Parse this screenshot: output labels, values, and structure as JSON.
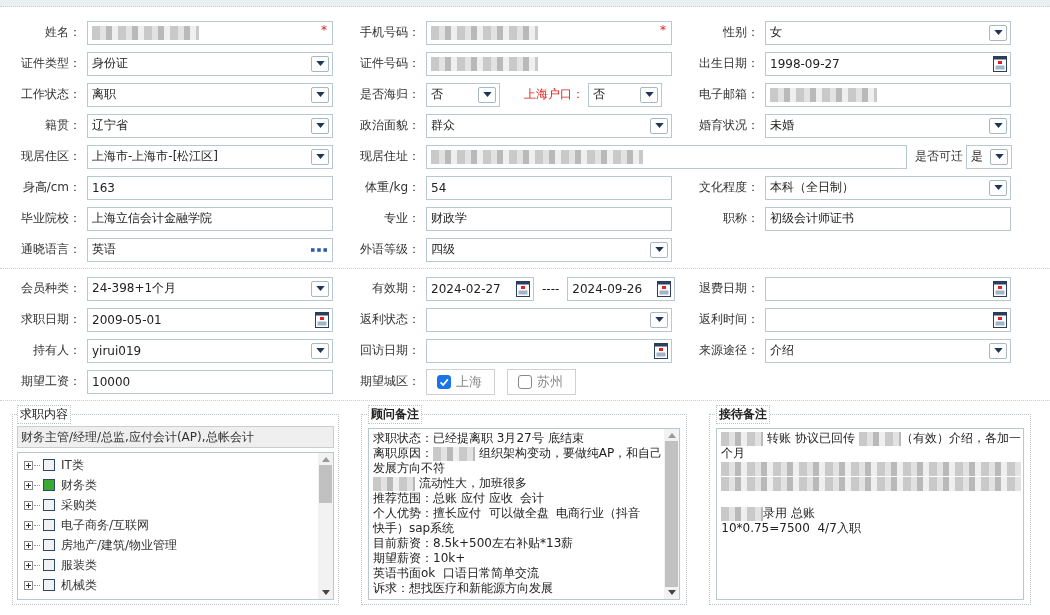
{
  "form_rows": [
    {
      "cells": [
        {
          "label": "姓名：",
          "parts": [
            {
              "kind": "blur",
              "required_mark": "*"
            }
          ]
        },
        {
          "label": "手机号码：",
          "parts": [
            {
              "kind": "blur",
              "required_mark": "*"
            }
          ]
        },
        {
          "label": "性别：",
          "parts": [
            {
              "kind": "select",
              "value": "女"
            }
          ]
        }
      ]
    },
    {
      "cells": [
        {
          "label": "证件类型：",
          "parts": [
            {
              "kind": "select",
              "value": "身份证"
            }
          ]
        },
        {
          "label": "证件号码：",
          "parts": [
            {
              "kind": "blur"
            }
          ]
        },
        {
          "label": "出生日期：",
          "parts": [
            {
              "kind": "date",
              "value": "1998-09-27"
            }
          ]
        }
      ]
    },
    {
      "cells": [
        {
          "label": "工作状态：",
          "parts": [
            {
              "kind": "select",
              "value": "离职"
            }
          ]
        },
        {
          "label": "是否海归：",
          "parts": [
            {
              "kind": "select",
              "value": "否"
            },
            {
              "kind": "label",
              "text": "上海户口：",
              "alert": true
            },
            {
              "kind": "select",
              "value": "否"
            }
          ]
        },
        {
          "label": "电子邮箱：",
          "parts": [
            {
              "kind": "blur"
            }
          ]
        }
      ]
    },
    {
      "cells": [
        {
          "label": "籍贯：",
          "parts": [
            {
              "kind": "select",
              "value": "辽宁省"
            }
          ]
        },
        {
          "label": "政治面貌：",
          "parts": [
            {
              "kind": "select",
              "value": "群众"
            }
          ]
        },
        {
          "label": "婚育状况：",
          "parts": [
            {
              "kind": "select",
              "value": "未婚"
            }
          ]
        }
      ]
    },
    {
      "cells": [
        {
          "label": "现居住区：",
          "parts": [
            {
              "kind": "select",
              "value": "上海市-上海市-[松江区]"
            }
          ]
        },
        {
          "label": "现居住址：",
          "wide": true,
          "parts": [
            {
              "kind": "blur"
            },
            {
              "kind": "label",
              "text": "是否可迁"
            },
            {
              "kind": "select",
              "value": "是"
            }
          ]
        }
      ]
    },
    {
      "cells": [
        {
          "label": "身高/cm：",
          "parts": [
            {
              "kind": "text",
              "value": "163"
            }
          ]
        },
        {
          "label": "体重/kg：",
          "parts": [
            {
              "kind": "text",
              "value": "54"
            }
          ]
        },
        {
          "label": "文化程度：",
          "parts": [
            {
              "kind": "select",
              "value": "本科（全日制）"
            }
          ]
        }
      ]
    },
    {
      "cells": [
        {
          "label": "毕业院校：",
          "parts": [
            {
              "kind": "text",
              "value": "上海立信会计金融学院"
            }
          ]
        },
        {
          "label": "专业：",
          "parts": [
            {
              "kind": "text",
              "value": "财政学"
            }
          ]
        },
        {
          "label": "职称：",
          "parts": [
            {
              "kind": "text",
              "value": "初级会计师证书"
            }
          ]
        }
      ]
    },
    {
      "cells": [
        {
          "label": "通晓语言：",
          "parts": [
            {
              "kind": "more",
              "value": "英语"
            }
          ]
        },
        {
          "label": "外语等级：",
          "parts": [
            {
              "kind": "select",
              "value": "四级"
            }
          ]
        }
      ]
    }
  ],
  "member_rows": [
    {
      "cells": [
        {
          "label": "会员种类：",
          "parts": [
            {
              "kind": "select",
              "value": "24-398+1个月"
            }
          ]
        },
        {
          "label": "有效期：",
          "parts": [
            {
              "kind": "date",
              "value": "2024-02-27"
            },
            {
              "kind": "dash",
              "text": "----"
            },
            {
              "kind": "date",
              "value": "2024-09-26"
            }
          ]
        },
        {
          "label": "退费日期：",
          "parts": [
            {
              "kind": "date"
            }
          ]
        }
      ]
    },
    {
      "cells": [
        {
          "label": "求职日期：",
          "parts": [
            {
              "kind": "date",
              "value": "2009-05-01"
            }
          ]
        },
        {
          "label": "返利状态：",
          "parts": [
            {
              "kind": "select"
            }
          ]
        },
        {
          "label": "返利时间：",
          "parts": [
            {
              "kind": "date"
            }
          ]
        }
      ]
    },
    {
      "cells": [
        {
          "label": "持有人：",
          "parts": [
            {
              "kind": "select",
              "value": "yirui019"
            }
          ]
        },
        {
          "label": "回访日期：",
          "parts": [
            {
              "kind": "date"
            }
          ]
        },
        {
          "label": "来源途径：",
          "parts": [
            {
              "kind": "select",
              "value": "介绍"
            }
          ]
        }
      ]
    },
    {
      "cells": [
        {
          "label": "期望工资：",
          "parts": [
            {
              "kind": "text",
              "value": "10000"
            }
          ]
        },
        {
          "label": "期望城区：",
          "parts": [
            {
              "kind": "checkbox",
              "text": "上海",
              "checked": true
            },
            {
              "kind": "checkbox",
              "text": "苏州",
              "checked": false
            }
          ]
        }
      ]
    }
  ],
  "job_panel": {
    "legend": "求职内容",
    "summary": "财务主管/经理/总监,应付会计(AP),总帐会计",
    "tree": [
      {
        "label": "IT类",
        "checked": false,
        "expanded": false
      },
      {
        "label": "财务类",
        "checked": true,
        "expanded": false
      },
      {
        "label": "采购类",
        "checked": false,
        "expanded": false
      },
      {
        "label": "电子商务/互联网",
        "checked": false,
        "expanded": false
      },
      {
        "label": "房地产/建筑/物业管理",
        "checked": false,
        "expanded": false
      },
      {
        "label": "服装类",
        "checked": false,
        "expanded": false
      },
      {
        "label": "机械类",
        "checked": false,
        "expanded": false
      }
    ]
  },
  "note_panels": [
    {
      "legend": "顾问备注",
      "lines": [
        {
          "kind": "text",
          "parts": [
            {
              "kind": "text",
              "text": "求职状态：已经提离职 3月27号 底结束"
            }
          ]
        },
        {
          "kind": "text",
          "parts": [
            {
              "kind": "text",
              "text": "离职原因："
            },
            {
              "kind": "blur"
            },
            {
              "kind": "text",
              "text": " 组织架构变动，要做纯AP，和自己"
            }
          ]
        },
        {
          "kind": "text",
          "parts": [
            {
              "kind": "text",
              "text": "发展方向不符"
            }
          ]
        },
        {
          "kind": "text",
          "parts": [
            {
              "kind": "blur"
            },
            {
              "kind": "text",
              "text": " 流动性大，加班很多"
            }
          ]
        },
        {
          "kind": "text",
          "parts": [
            {
              "kind": "text",
              "text": "推荐范围：总账 应付 应收  会计"
            }
          ]
        },
        {
          "kind": "text",
          "parts": [
            {
              "kind": "text",
              "text": "个人优势：擅长应付  可以做全盘  电商行业（抖音"
            }
          ]
        },
        {
          "kind": "text",
          "parts": [
            {
              "kind": "text",
              "text": "快手）sap系统"
            }
          ]
        },
        {
          "kind": "text",
          "parts": [
            {
              "kind": "text",
              "text": "目前薪资：8.5k+500左右补贴*13薪"
            }
          ]
        },
        {
          "kind": "text",
          "parts": [
            {
              "kind": "text",
              "text": "期望薪资：10k+"
            }
          ]
        },
        {
          "kind": "text",
          "parts": [
            {
              "kind": "text",
              "text": "英语书面ok  口语日常简单交流"
            }
          ]
        },
        {
          "kind": "text",
          "parts": [
            {
              "kind": "text",
              "text": "诉求：想找医疗和新能源方向发展"
            }
          ]
        }
      ],
      "scrollbar": true
    },
    {
      "legend": "接待备注",
      "lines": [
        {
          "kind": "text",
          "parts": [
            {
              "kind": "blur"
            },
            {
              "kind": "text",
              "text": " 转账 协议已回传 "
            },
            {
              "kind": "blur"
            },
            {
              "kind": "text",
              "text": "（有效）介绍，各加一"
            }
          ]
        },
        {
          "kind": "text",
          "parts": [
            {
              "kind": "text",
              "text": "个月"
            }
          ]
        },
        {
          "kind": "text",
          "parts": [
            {
              "kind": "blur"
            }
          ]
        },
        {
          "kind": "text",
          "parts": [
            {
              "kind": "blur"
            }
          ]
        },
        {
          "kind": "blank"
        },
        {
          "kind": "text",
          "parts": [
            {
              "kind": "blur"
            },
            {
              "kind": "text",
              "text": "录用 总账"
            }
          ]
        },
        {
          "kind": "text",
          "parts": [
            {
              "kind": "text",
              "text": "10*0.75=7500  4/7入职"
            }
          ]
        }
      ],
      "scrollbar": false
    }
  ]
}
